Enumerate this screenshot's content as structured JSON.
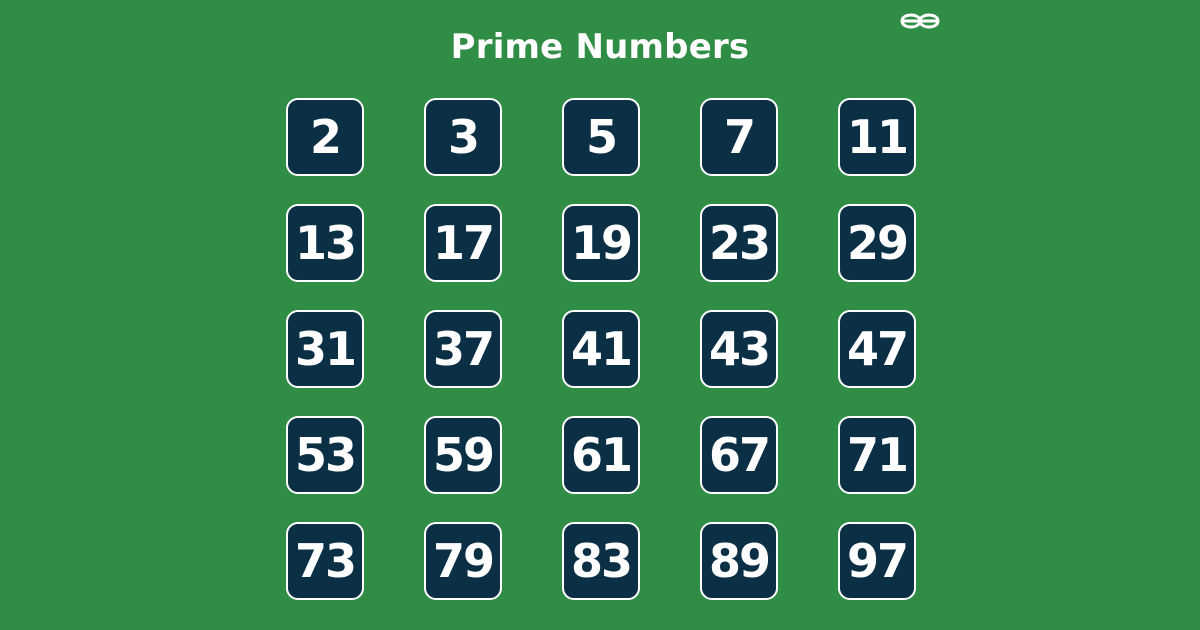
{
  "title": "Prime Numbers",
  "logo": {
    "icon": "gfg-logo-icon"
  },
  "numbers": [
    "2",
    "3",
    "5",
    "7",
    "11",
    "13",
    "17",
    "19",
    "23",
    "29",
    "31",
    "37",
    "41",
    "43",
    "47",
    "53",
    "59",
    "61",
    "67",
    "71",
    "73",
    "79",
    "83",
    "89",
    "97"
  ],
  "colors": {
    "background": "#308d46",
    "tile_fill": "#0b2f45",
    "tile_border": "#ffffff",
    "text": "#ffffff"
  }
}
